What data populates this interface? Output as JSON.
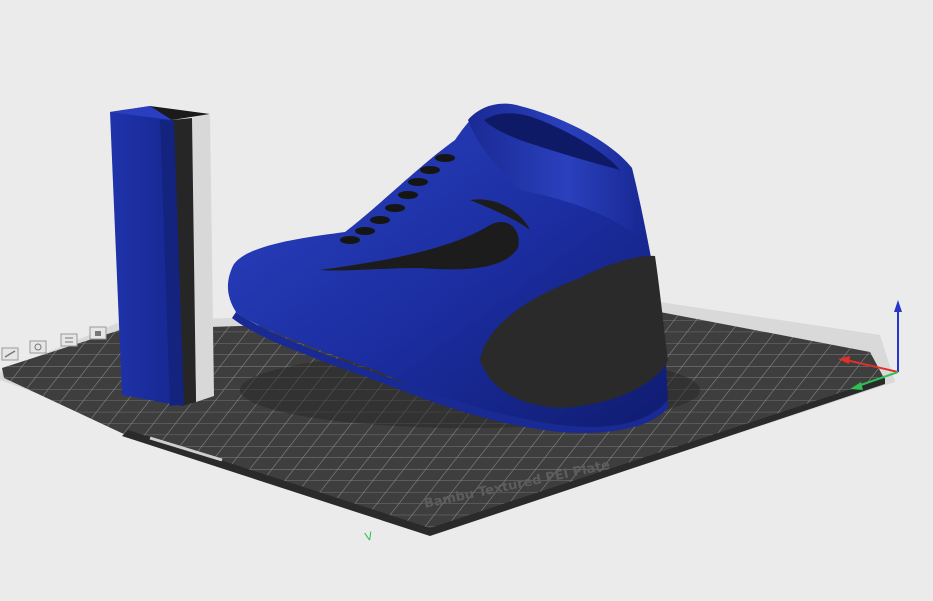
{
  "viewport": {
    "name": "3D build plate viewport",
    "background": "#ebebeb"
  },
  "build_plate": {
    "label": "Bambu Textured PEI Plate",
    "surface_color": "#3e3e3e",
    "grid_color": "#8a8a8a",
    "rim_color": "#d9d9d9",
    "origin_marker": "V"
  },
  "objects": [
    {
      "name": "wipe-tower",
      "colors": [
        "#1a2fa0",
        "#262626",
        "#d8d8d8"
      ]
    },
    {
      "name": "sneaker",
      "colors": [
        "#1c2fa3",
        "#2a2a2a",
        "#161616"
      ]
    }
  ],
  "axes": {
    "x_color": "#e0302a",
    "y_color": "#2fbf54",
    "z_color": "#2437c9"
  },
  "plate_toolbar_icons": [
    "arrange-icon",
    "orient-icon",
    "plate-settings-icon",
    "lock-icon"
  ]
}
